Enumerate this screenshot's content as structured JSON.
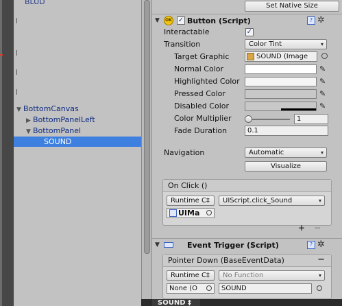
{
  "hierarchy": {
    "top_item": "BLUD",
    "items": [
      {
        "label": "BottomCanvas",
        "tri": "▼"
      },
      {
        "label": "BottomPanelLeft",
        "tri": "▶"
      },
      {
        "label": "BottomPanel",
        "tri": "▼"
      },
      {
        "label": "SOUND",
        "tri": ""
      }
    ]
  },
  "inspector": {
    "set_native_size_label": "Set Native Size",
    "button_component": {
      "title": "Button (Script)",
      "badge": "OK",
      "interactable_label": "Interactable",
      "interactable_checked": true,
      "transition_label": "Transition",
      "transition_value": "Color Tint",
      "target_graphic_label": "Target Graphic",
      "target_graphic_value": "SOUND (Image",
      "normal_color_label": "Normal Color",
      "highlighted_color_label": "Highlighted Color",
      "pressed_color_label": "Pressed Color",
      "disabled_color_label": "Disabled Color",
      "color_multiplier_label": "Color Multiplier",
      "color_multiplier_value": "1",
      "fade_duration_label": "Fade Duration",
      "fade_duration_value": "0.1",
      "navigation_label": "Navigation",
      "navigation_value": "Automatic",
      "visualize_label": "Visualize",
      "colors": {
        "normal": "#ffffff",
        "highlighted": "#f5f5f5",
        "pressed": "#c8c8c8",
        "disabled": "#c8c8c8"
      }
    },
    "on_click": {
      "header": "On Click ()",
      "runtime_label": "Runtime C‡",
      "function_value": "UIScript.click_Sound",
      "object_value": "UIMa",
      "plus": "+",
      "minus": "−"
    },
    "event_trigger": {
      "title": "Event Trigger (Script)",
      "entry_header": "Pointer Down (BaseEventData)",
      "entry_minus": "−",
      "runtime_label": "Runtime C‡",
      "function_value": "No Function",
      "object_value": "None (O",
      "param_value": "SOUND"
    }
  },
  "bottom_tab": {
    "label": "SOUND ‡"
  }
}
